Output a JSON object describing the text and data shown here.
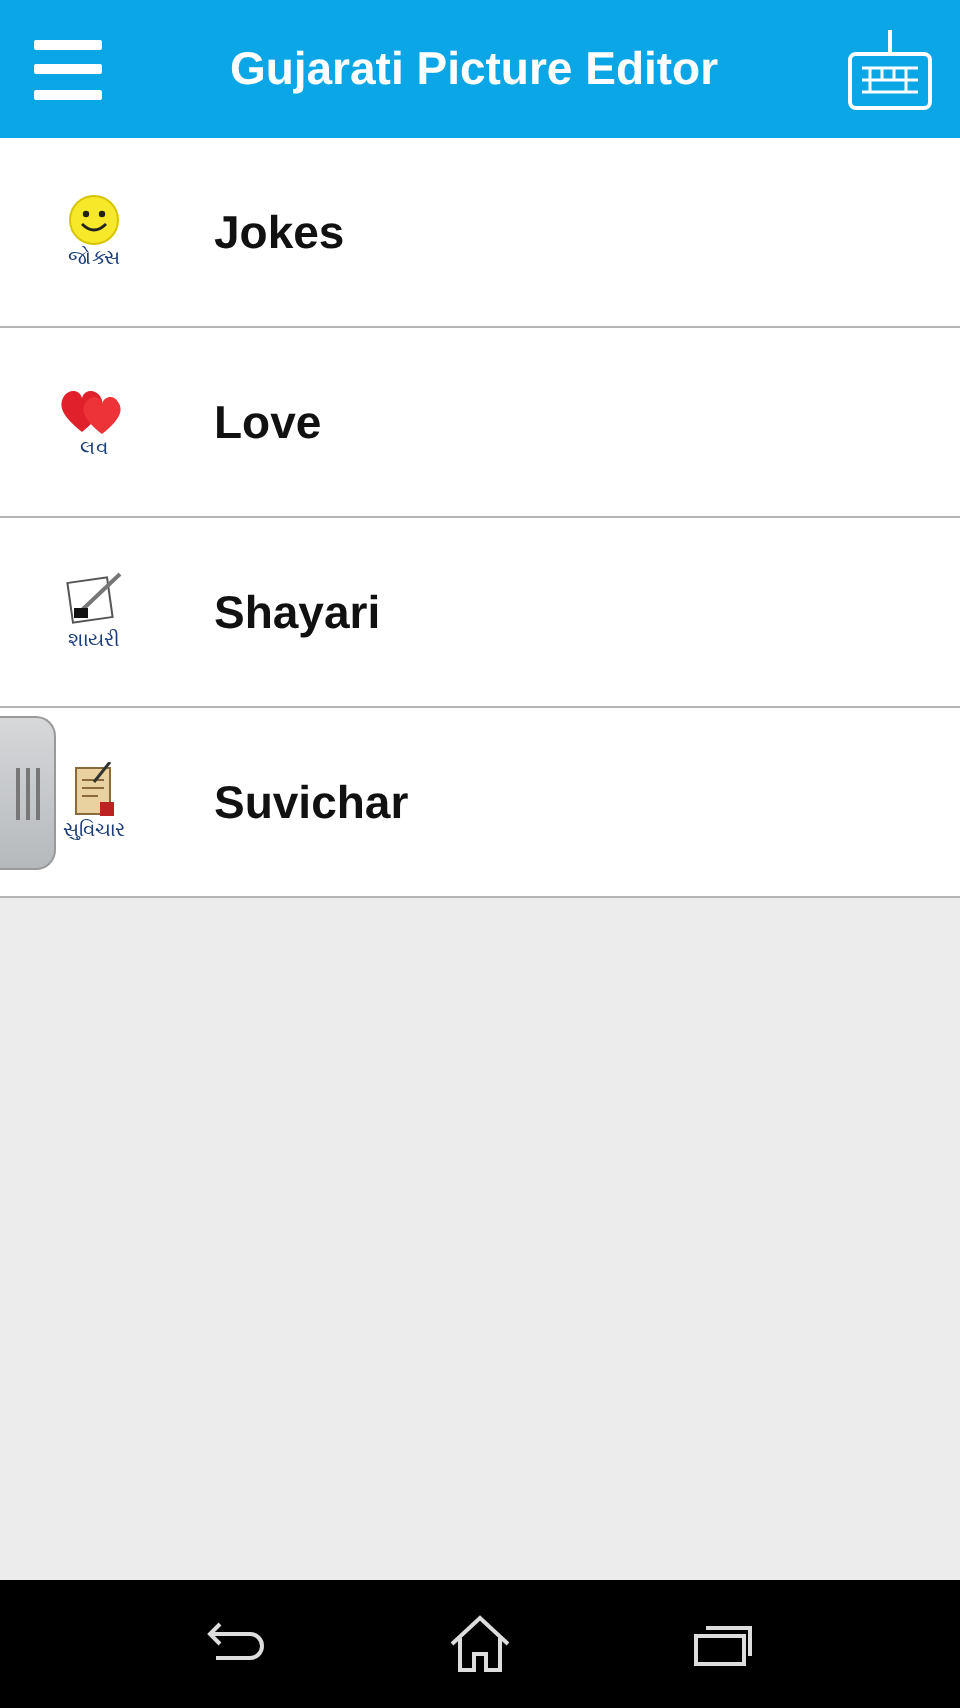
{
  "app_bar": {
    "title": "Gujarati Picture Editor"
  },
  "categories": [
    {
      "kind": "smiley",
      "caption": "જોક્સ",
      "label": "Jokes"
    },
    {
      "kind": "hearts",
      "caption": "લવ",
      "label": "Love"
    },
    {
      "kind": "quill",
      "caption": "શાયરી",
      "label": "Shayari"
    },
    {
      "kind": "scroll",
      "caption": "સુવિચાર",
      "label": "Suvichar"
    }
  ]
}
